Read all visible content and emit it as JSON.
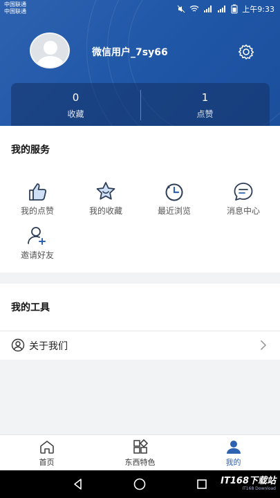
{
  "statusbar": {
    "carrier_1": "中国联通",
    "carrier_2": "中国联通",
    "time": "上午9:33",
    "icons": [
      "mute-icon",
      "wifi-icon",
      "signal-icon",
      "signal-icon",
      "battery-icon"
    ]
  },
  "profile": {
    "username": "微信用户_7sy66",
    "settings_icon": "gear-icon"
  },
  "stats": {
    "favorites_count": "0",
    "favorites_label": "收藏",
    "likes_count": "1",
    "likes_label": "点赞"
  },
  "services": {
    "title": "我的服务",
    "items": [
      {
        "label": "我的点赞",
        "icon": "thumbs-up-icon"
      },
      {
        "label": "我的收藏",
        "icon": "star-icon"
      },
      {
        "label": "最近浏览",
        "icon": "history-icon"
      },
      {
        "label": "消息中心",
        "icon": "message-icon"
      },
      {
        "label": "邀请好友",
        "icon": "add-user-icon"
      }
    ]
  },
  "tools": {
    "title": "我的工具",
    "items": [
      {
        "label": "关于我们",
        "icon": "user-circle-icon"
      }
    ]
  },
  "tabbar": {
    "tabs": [
      {
        "label": "首页",
        "icon": "home-icon"
      },
      {
        "label": "东西特色",
        "icon": "grid-icon"
      },
      {
        "label": "我的",
        "icon": "person-icon"
      }
    ],
    "active_color": "#2d62b0"
  },
  "colors": {
    "header": "#2d62b0",
    "accent": "#2d62b0"
  },
  "watermark": {
    "text": "IT168下载站",
    "sub": "IT168 Download"
  }
}
